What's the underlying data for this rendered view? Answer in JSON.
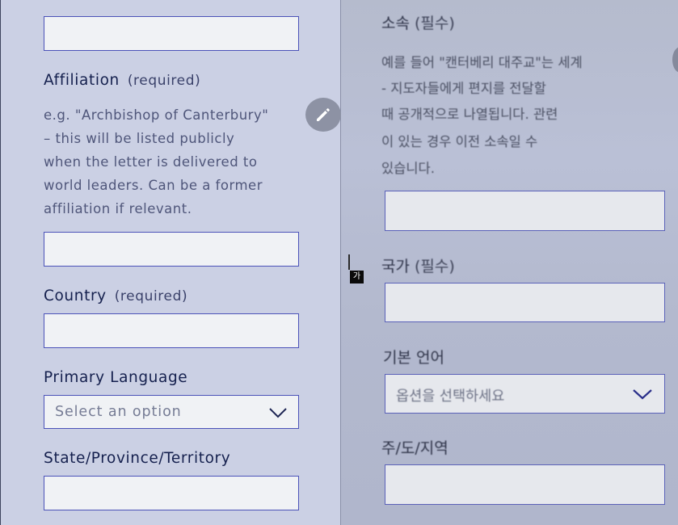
{
  "english_form": {
    "affiliation": {
      "label": "Affiliation",
      "required": "(required)",
      "help_lines": [
        "e.g. \"Archbishop of Canterbury\"",
        "– this will be listed publicly",
        "when the letter is delivered to",
        "world leaders. Can be a former",
        "affiliation if relevant."
      ],
      "value": ""
    },
    "country": {
      "label": "Country",
      "required": "(required)",
      "value": ""
    },
    "primary_language": {
      "label": "Primary Language",
      "placeholder": "Select an option"
    },
    "state": {
      "label": "State/Province/Territory",
      "value": ""
    }
  },
  "korean_form": {
    "affiliation": {
      "label": "소속",
      "required": "(필수)",
      "help_lines": [
        "예를 들어 \"캔터베리 대주교\"는 세계",
        "- 지도자들에게 편지를 전달할",
        "때 공개적으로 나열됩니다. 관련",
        "이 있는 경우 이전 소속일 수",
        "있습니다."
      ]
    },
    "country": {
      "label": "국가",
      "required": "(필수)"
    },
    "primary_language": {
      "label": "기본 언어",
      "placeholder": "옵션을 선택하세요"
    },
    "state": {
      "label": "주/도/지역"
    }
  },
  "ime_indicator": "가",
  "icons": {
    "edit": "pencil-icon",
    "dropdown": "chevron-down-icon"
  },
  "colors": {
    "left_background": "#cbd0e4",
    "field_border": "#4b52b8",
    "label_text": "#15204e"
  }
}
